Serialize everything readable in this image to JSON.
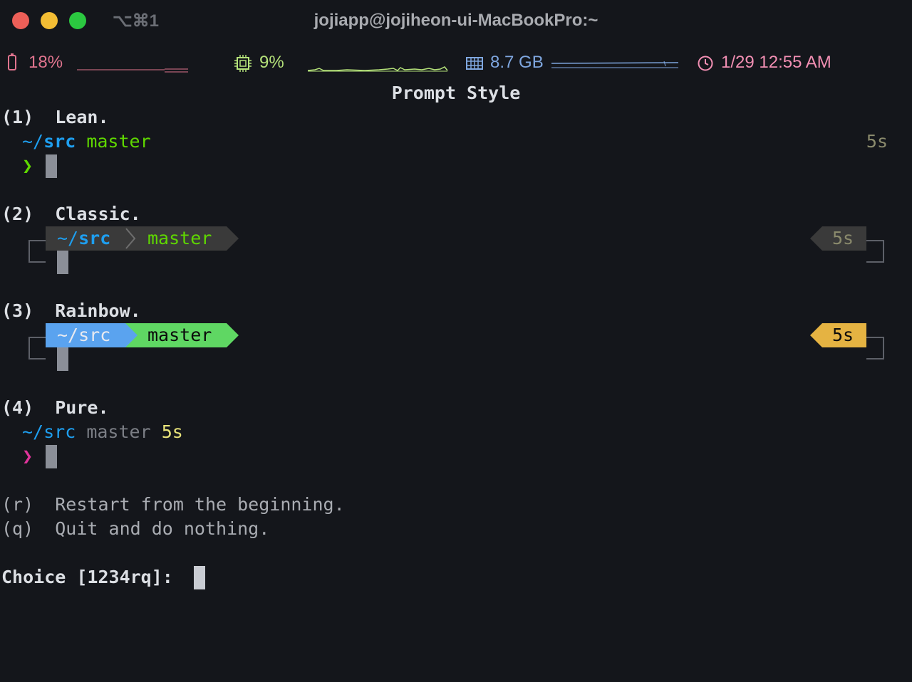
{
  "window": {
    "shortcut": "⌥⌘1",
    "title": "jojiapp@jojiheon-ui-MacBookPro:~"
  },
  "status_bar": {
    "battery": {
      "value": "18%",
      "icon": "battery-icon",
      "color": "#e0748e"
    },
    "cpu": {
      "value": "9%",
      "icon": "cpu-icon",
      "color": "#b5e27a"
    },
    "memory": {
      "value": "8.7 GB",
      "icon": "memory-icon",
      "color": "#7fa7e0"
    },
    "clock": {
      "value": "1/29 12:55 AM",
      "icon": "clock-icon",
      "color": "#f28fb3"
    }
  },
  "heading": "Prompt Style",
  "options": {
    "lean": {
      "label": "(1)  Lean.",
      "dir_tilde": "~/",
      "dir_name": "src",
      "branch": "master",
      "duration": "5s",
      "prompt_char": "❯"
    },
    "classic": {
      "label": "(2)  Classic.",
      "dir_tilde": "~/",
      "dir_name": "src",
      "branch": "master",
      "duration": "5s"
    },
    "rainbow": {
      "label": "(3)  Rainbow.",
      "dir": "~/src",
      "branch": "master",
      "duration": "5s"
    },
    "pure": {
      "label": "(4)  Pure.",
      "dir": "~/src",
      "branch": "master",
      "duration": "5s",
      "prompt_char": "❯"
    }
  },
  "extra_options": {
    "restart": "(r)  Restart from the beginning.",
    "quit": "(q)  Quit and do nothing."
  },
  "choice_prompt": "Choice [1234rq]: ",
  "colors": {
    "background": "#14161b",
    "traffic_close": "#ec5f58",
    "traffic_min": "#f3bd34",
    "traffic_max": "#2bc840",
    "dir_blue": "#1e9ff0",
    "git_green": "#5fd700",
    "rainbow_blue": "#5aa3ef",
    "rainbow_green": "#5fd763",
    "duration_yellow": "#e5b342",
    "pure_pink": "#e0349b"
  }
}
